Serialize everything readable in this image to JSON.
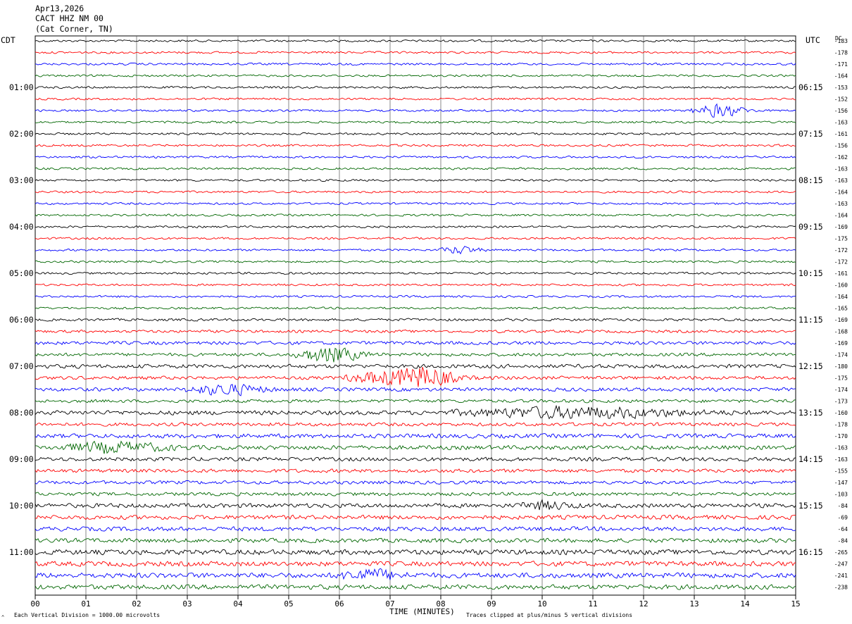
{
  "header": {
    "date": "Apr13,2026",
    "station": "CACT HHZ NM 00",
    "location": "(Cat Corner, TN)"
  },
  "left_tz": "CDT",
  "right_tz": "UTC",
  "dc_label": "DC",
  "footer": {
    "scale_note": "Each Vertical Division = 1000.00 microvolts",
    "clip_note": "Traces clipped at plus/minus 5 vertical divisions",
    "corner_mark": "^"
  },
  "colors": {
    "trace_cycle": [
      "#000000",
      "#ff0000",
      "#0000ff",
      "#006600"
    ],
    "grid": "#000000"
  },
  "chart_data": {
    "type": "line",
    "title": "",
    "xlabel": "TIME (MINUTES)",
    "xlim": [
      0,
      15
    ],
    "x_ticks": [
      "00",
      "01",
      "02",
      "03",
      "04",
      "05",
      "06",
      "07",
      "08",
      "09",
      "10",
      "11",
      "12",
      "13",
      "14",
      "15"
    ],
    "left_hour_labels": [
      "01:00",
      "02:00",
      "03:00",
      "04:00",
      "05:00",
      "06:00",
      "07:00",
      "08:00",
      "09:00",
      "10:00",
      "11:00"
    ],
    "right_hour_labels": [
      "06:15",
      "07:15",
      "08:15",
      "09:15",
      "10:15",
      "11:15",
      "12:15",
      "13:15",
      "14:15",
      "15:15",
      "16:15"
    ],
    "trace_count": 48,
    "dc_offsets": [
      -183,
      -178,
      -171,
      -164,
      -153,
      -152,
      -156,
      -163,
      -161,
      -156,
      -162,
      -163,
      -163,
      -164,
      -163,
      -164,
      -169,
      -175,
      -172,
      -172,
      -161,
      -160,
      -164,
      -165,
      -169,
      -168,
      -169,
      -174,
      -180,
      -175,
      -174,
      -173,
      -160,
      -178,
      -170,
      -163,
      -163,
      -155,
      -147,
      -103,
      -84,
      -69,
      -64,
      -84,
      -265,
      -247,
      -241,
      -238
    ],
    "trace_amplitude_levels": [
      1,
      1,
      1,
      1,
      1,
      1,
      1,
      1,
      1,
      1,
      1,
      1,
      1,
      1,
      1,
      1,
      1,
      1,
      1,
      1,
      1,
      1,
      1,
      1,
      1.2,
      1.3,
      1.6,
      1.5,
      1.8,
      1.6,
      1.7,
      1.5,
      2,
      1.6,
      2,
      2,
      1.8,
      1.7,
      1.6,
      1.6,
      2,
      2,
      2,
      2,
      2.4,
      2.3,
      2.4,
      2.2
    ],
    "events": [
      {
        "trace": 6,
        "minute": 13.25,
        "amplitude": 5,
        "duration": 0.8
      },
      {
        "trace": 18,
        "minute": 8.2,
        "amplitude": 3,
        "duration": 0.6
      },
      {
        "trace": 27,
        "minute": 5.5,
        "amplitude": 6,
        "duration": 1.0
      },
      {
        "trace": 29,
        "minute": 6.7,
        "amplitude": 6,
        "duration": 1.5
      },
      {
        "trace": 29,
        "minute": 7.5,
        "amplitude": 5,
        "duration": 0.8
      },
      {
        "trace": 30,
        "minute": 3.4,
        "amplitude": 4,
        "duration": 1.2
      },
      {
        "trace": 32,
        "minute": 9.6,
        "amplitude": 4,
        "duration": 3.5
      },
      {
        "trace": 35,
        "minute": 1.1,
        "amplitude": 4,
        "duration": 1.6
      },
      {
        "trace": 40,
        "minute": 9.8,
        "amplitude": 3,
        "duration": 0.8
      },
      {
        "trace": 46,
        "minute": 6.3,
        "amplitude": 4,
        "duration": 1.0
      }
    ]
  }
}
